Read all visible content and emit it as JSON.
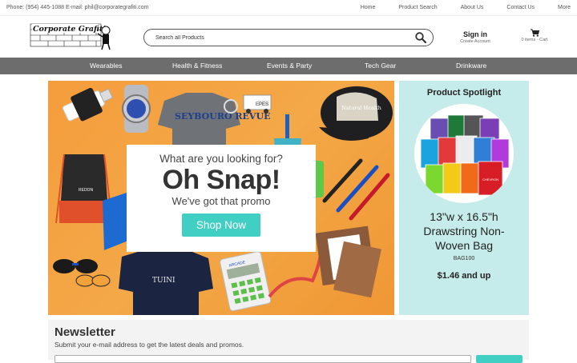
{
  "topbar": {
    "contact": "Phone: (954) 445-1088 E-mail: phil@corporategrafiti.com",
    "nav": [
      "Home",
      "Product Search",
      "About Us",
      "Contact Us",
      "More"
    ]
  },
  "header": {
    "logo_text": "Corporate Grafiti",
    "search_placeholder": "Search all Products",
    "signin_title": "Sign in",
    "signin_sub": "Create Account",
    "cart_label": "0 items - Cart"
  },
  "categories": [
    "Wearables",
    "Health & Fitness",
    "Events & Party",
    "Tech Gear",
    "Drinkware"
  ],
  "hero": {
    "question": "What are you looking for?",
    "headline": "Oh Snap!",
    "subline": "We've got that promo",
    "cta": "Shop Now",
    "tshirt_text": "SEYBOURO REVUE",
    "cap_text": "Natural Health",
    "navy_shirt_text": "TUINI",
    "calculator_brand": "ARCADE",
    "truck_text": "EPES",
    "bag_tag": "REDON"
  },
  "spotlight": {
    "heading": "Product Spotlight",
    "product_name": "13\"w x 16.5\"h Drawstring Non-Woven Bag",
    "sku": "BAG100",
    "price": "$1.46 and up",
    "bag_brand": "CHEVRON"
  },
  "newsletter": {
    "heading": "Newsletter",
    "description": "Submit your e-mail address to get the latest deals and promos."
  },
  "colors": {
    "accent": "#41cfc3",
    "nav_bg": "#6d6d6d",
    "hero_bg": "#f4a847",
    "spotlight_bg": "#c5ecea"
  }
}
